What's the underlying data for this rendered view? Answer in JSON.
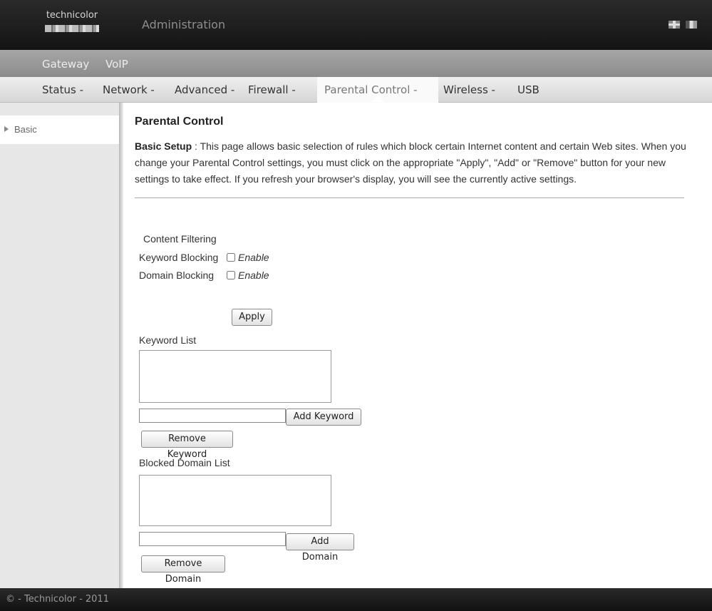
{
  "header": {
    "logo_text": "technicolor",
    "title": "Administration"
  },
  "topnav": {
    "items": [
      "Gateway",
      "VoIP"
    ]
  },
  "subnav": {
    "items": [
      "Status -",
      "Network -",
      "Advanced -",
      "Firewall -",
      "Parental Control -",
      "Wireless -",
      "USB"
    ],
    "active": "Parental Control -"
  },
  "sidebar": {
    "items": [
      {
        "label": "Basic"
      }
    ]
  },
  "main": {
    "title": "Parental Control",
    "desc_label": "Basic Setup",
    "desc_sep": " : ",
    "desc_text": "This page allows basic selection of rules which block certain Internet content and certain Web sites. When you change your Parental Control settings, you must click on the appropriate \"Apply\", \"Add\" or \"Remove\" button for your new settings to take effect. If you refresh your browser's display, you will see the currently active settings.",
    "content_filtering": "Content Filtering",
    "keyword_blocking": "Keyword Blocking",
    "domain_blocking": "Domain Blocking",
    "enable": "Enable",
    "keyword_blocking_enabled": false,
    "domain_blocking_enabled": false,
    "apply": "Apply",
    "keyword_list": "Keyword List",
    "keyword_input_value": "",
    "add_keyword": "Add Keyword",
    "remove_keyword": "Remove Keyword",
    "domain_list": "Blocked Domain List",
    "domain_input_value": "",
    "add_domain": "Add Domain",
    "remove_domain": "Remove Domain"
  },
  "footer": {
    "text": "© - Technicolor - 2011"
  },
  "colors": {
    "header_bg": "#1e1e1e",
    "topnav_bg": "#999999",
    "subnav_bg": "#e4e4e4",
    "sidebar_bg": "#e7e7e7"
  },
  "icons": [
    "language-flag-icon",
    "window-icon",
    "expand-arrow-icon"
  ]
}
